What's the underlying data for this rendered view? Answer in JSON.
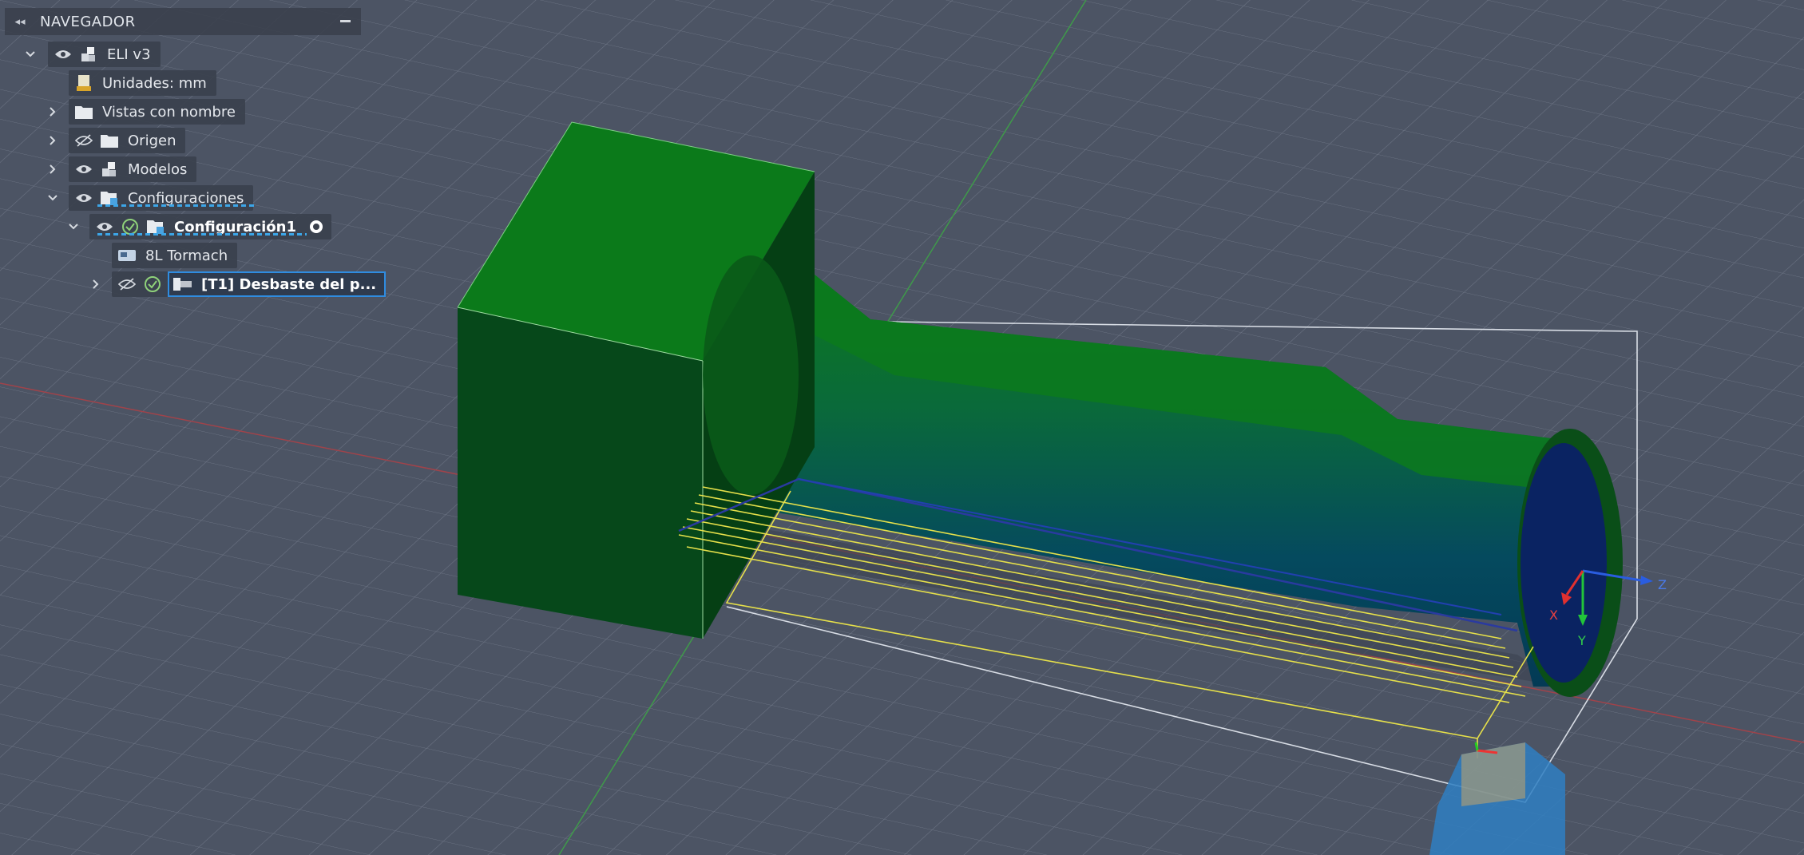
{
  "browser": {
    "title": "NAVEGADOR",
    "tree": {
      "root_label": "ELI v3",
      "units_label": "Unidades: mm",
      "named_views_label": "Vistas con nombre",
      "origin_label": "Origen",
      "models_label": "Modelos",
      "setups_label": "Configuraciones",
      "setup1_label": "Configuración1",
      "machine_label": "8L Tormach",
      "operation_label": "[T1] Desbaste del p..."
    }
  },
  "viewport": {
    "axis_labels": {
      "x": "X",
      "y": "Y",
      "z": "Z"
    },
    "colors": {
      "background": "#4c5464",
      "stock_green": "#0d7a1a",
      "toolpath_yellow": "#e6e04a",
      "selection_blue": "#2f8ce0"
    }
  }
}
